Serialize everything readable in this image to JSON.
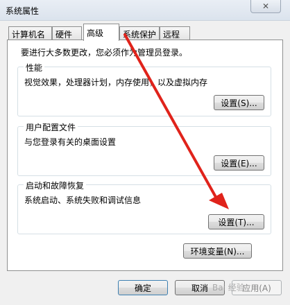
{
  "window": {
    "title": "系统属性"
  },
  "tabs": [
    "计算机名",
    "硬件",
    "高级",
    "系统保护",
    "远程"
  ],
  "intro": "要进行大多数更改，您必须作为管理员登录。",
  "groups": {
    "performance": {
      "title": "性能",
      "desc": "视觉效果，处理器计划，内存使用，以及虚拟内存",
      "button": "设置(S)..."
    },
    "profiles": {
      "title": "用户配置文件",
      "desc": "与您登录有关的桌面设置",
      "button": "设置(E)..."
    },
    "startup": {
      "title": "启动和故障恢复",
      "desc": "系统启动、系统失败和调试信息",
      "button": "设置(T)..."
    }
  },
  "env_button": "环境变量(N)...",
  "footer": {
    "ok": "确定",
    "cancel": "取消",
    "apply": "应用(A)"
  },
  "watermark": "Bai 经验",
  "colors": {
    "arrow": "#e0231b"
  }
}
